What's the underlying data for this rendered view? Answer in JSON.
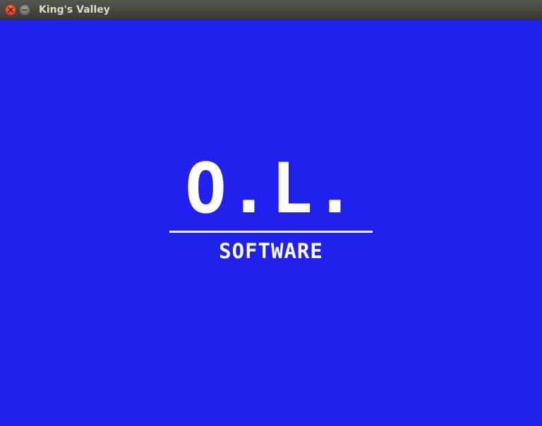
{
  "window": {
    "title": "King's Valley"
  },
  "titlebar": {
    "close_icon": "close-icon",
    "minimize_icon": "minimize-icon"
  },
  "colors": {
    "background": "#2020ef",
    "logo": "#ffffff",
    "close_button": "#dd4814"
  },
  "splash": {
    "logo_main": "O.L.",
    "logo_sub": "SOFTWARE"
  }
}
